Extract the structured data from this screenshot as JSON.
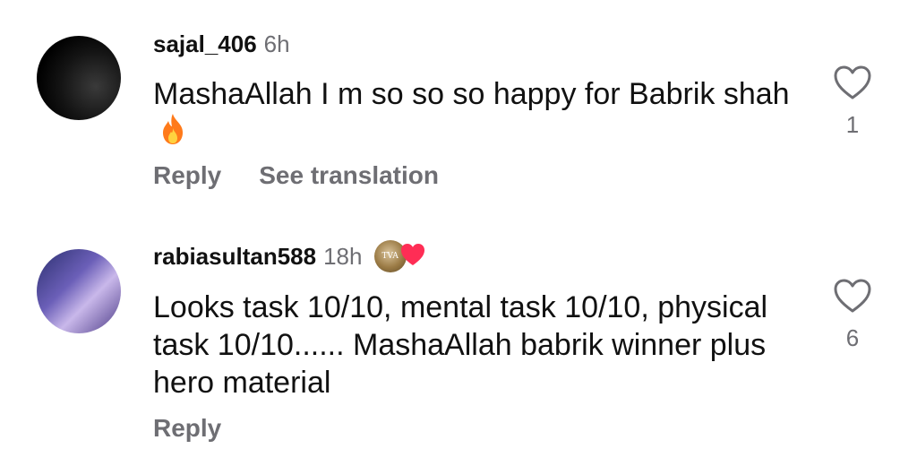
{
  "comments": [
    {
      "username": "sajal_406",
      "time": "6h",
      "text": "MashaAllah I m so so so happy for Babrik shah",
      "emoji_icon": "fire-icon",
      "actions": {
        "reply": "Reply",
        "translate": "See translation"
      },
      "likes": "1"
    },
    {
      "username": "rabiasultan588",
      "time": "18h",
      "badge_icon": "coin-heart-badge-icon",
      "text": "Looks task 10/10, mental task 10/10, physical task 10/10...... MashaAllah babrik winner plus hero material",
      "actions": {
        "reply": "Reply"
      },
      "likes": "6"
    }
  ],
  "colors": {
    "text": "#111111",
    "muted": "#6e6e73",
    "heart_badge": "#ff2d55"
  }
}
